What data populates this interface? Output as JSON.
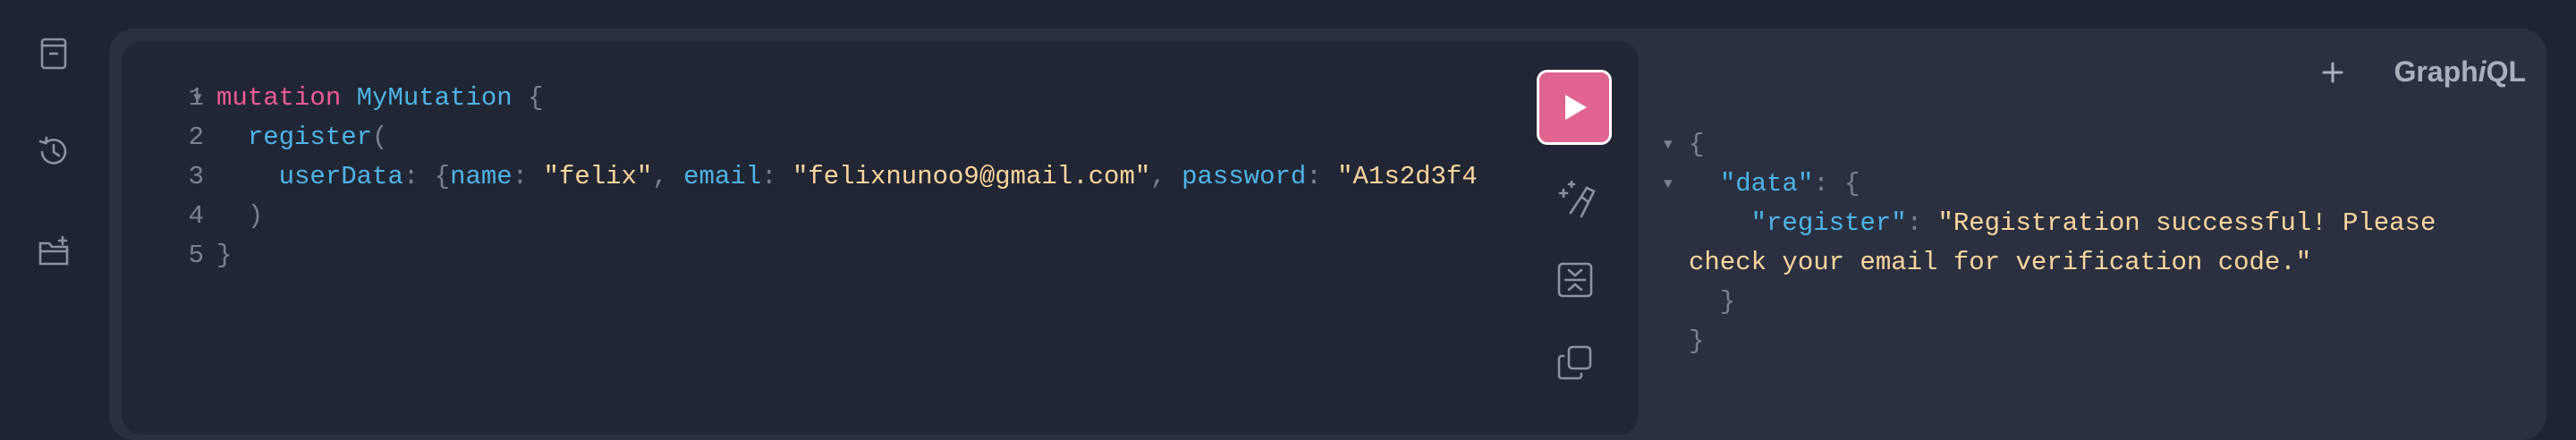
{
  "sidebar": {
    "icons": [
      "docs-icon",
      "history-icon",
      "collection-add-icon"
    ]
  },
  "editor": {
    "lines": [
      {
        "num": "1",
        "tokens": [
          {
            "t": "mutation",
            "c": "kw"
          },
          {
            "t": " ",
            "c": ""
          },
          {
            "t": "MyMutation",
            "c": "def"
          },
          {
            "t": " {",
            "c": "punct"
          }
        ]
      },
      {
        "num": "2",
        "tokens": [
          {
            "t": "  ",
            "c": ""
          },
          {
            "t": "register",
            "c": "field"
          },
          {
            "t": "(",
            "c": "punct"
          }
        ]
      },
      {
        "num": "3",
        "tokens": [
          {
            "t": "    ",
            "c": ""
          },
          {
            "t": "userData",
            "c": "argname"
          },
          {
            "t": ": {",
            "c": "punct"
          },
          {
            "t": "name",
            "c": "argname"
          },
          {
            "t": ": ",
            "c": "punct"
          },
          {
            "t": "\"felix\"",
            "c": "str"
          },
          {
            "t": ", ",
            "c": "punct"
          },
          {
            "t": "email",
            "c": "argname"
          },
          {
            "t": ": ",
            "c": "punct"
          },
          {
            "t": "\"felixnunoo9@gmail.com\"",
            "c": "str"
          },
          {
            "t": ", ",
            "c": "punct"
          },
          {
            "t": "password",
            "c": "argname"
          },
          {
            "t": ": ",
            "c": "punct"
          },
          {
            "t": "\"A1s2d3f4",
            "c": "str"
          }
        ]
      },
      {
        "num": "4",
        "tokens": [
          {
            "t": "  ",
            "c": ""
          },
          {
            "t": ")",
            "c": "punct"
          }
        ]
      },
      {
        "num": "5",
        "tokens": [
          {
            "t": "}",
            "c": "punct"
          }
        ]
      }
    ]
  },
  "toolbar": {
    "run_icon": "play-icon",
    "tools": [
      "prettify-icon",
      "merge-fragments-icon",
      "copy-icon"
    ]
  },
  "result": {
    "lines": [
      {
        "fold": true,
        "tokens": [
          {
            "t": "{",
            "c": "punct"
          }
        ]
      },
      {
        "fold": true,
        "tokens": [
          {
            "t": "  ",
            "c": ""
          },
          {
            "t": "\"data\"",
            "c": "rkey"
          },
          {
            "t": ": {",
            "c": "punct"
          }
        ]
      },
      {
        "fold": false,
        "tokens": [
          {
            "t": "    ",
            "c": ""
          },
          {
            "t": "\"register\"",
            "c": "rkey"
          },
          {
            "t": ": ",
            "c": "punct"
          },
          {
            "t": "\"Registration successful! Please",
            "c": "rstr"
          }
        ]
      },
      {
        "fold": false,
        "tokens": [
          {
            "t": "check your email for verification code.\"",
            "c": "rstr"
          }
        ]
      },
      {
        "fold": false,
        "tokens": [
          {
            "t": "  }",
            "c": "punct"
          }
        ]
      },
      {
        "fold": false,
        "tokens": [
          {
            "t": "}",
            "c": "punct"
          }
        ]
      }
    ]
  },
  "header": {
    "brand_prefix": "Graph",
    "brand_italic": "i",
    "brand_suffix": "QL"
  },
  "colors": {
    "accent": "#e0648f",
    "background": "#1f2433",
    "panel": "#2a3040",
    "editor": "#212634"
  }
}
